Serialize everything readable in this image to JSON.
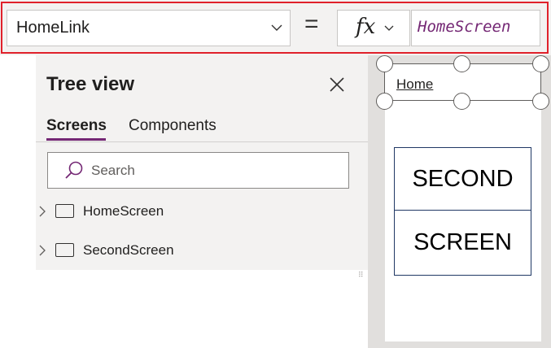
{
  "formula_bar": {
    "property": "HomeLink",
    "equals": "=",
    "fx_label": "fx",
    "formula": "HomeScreen",
    "highlight_color": "#e0212b"
  },
  "tree_view": {
    "title": "Tree view",
    "tabs": [
      {
        "label": "Screens",
        "selected": true
      },
      {
        "label": "Components",
        "selected": false
      }
    ],
    "search_placeholder": "Search",
    "items": [
      {
        "label": "HomeScreen",
        "icon": "screen-icon",
        "expander": "chevron-right-icon"
      },
      {
        "label": "SecondScreen",
        "icon": "screen-icon",
        "expander": "chevron-right-icon"
      }
    ],
    "accent_color": "#742774"
  },
  "canvas": {
    "home_link_text": "Home",
    "labels": [
      "SECOND",
      "SCREEN"
    ]
  }
}
